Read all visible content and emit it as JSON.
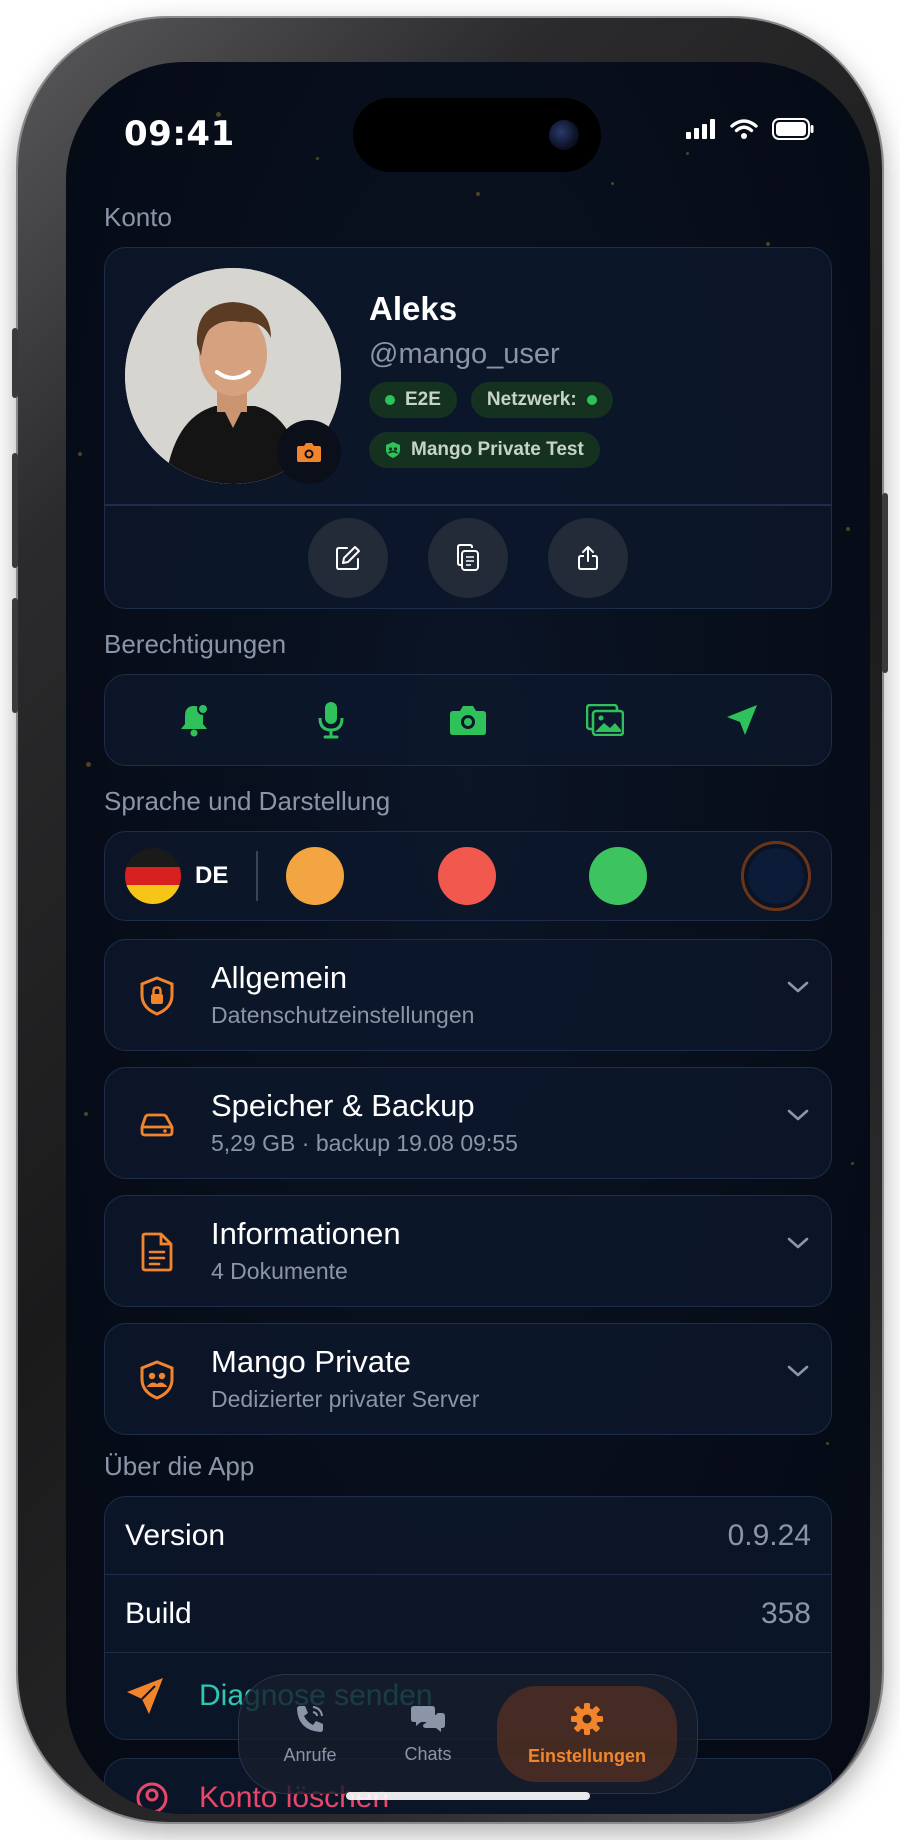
{
  "status_bar": {
    "time": "09:41"
  },
  "account": {
    "section_label": "Konto",
    "name": "Aleks",
    "handle": "@mango_user",
    "chips": [
      "E2E",
      "Netzwerk:",
      "Mango Private Test"
    ]
  },
  "permissions": {
    "section_label": "Berechtigungen",
    "icons": [
      "bell-icon",
      "microphone-icon",
      "camera-icon",
      "gallery-icon",
      "location-arrow-icon"
    ]
  },
  "appearance": {
    "section_label": "Sprache und Darstellung",
    "language_code": "DE",
    "swatches": [
      "#f2a541",
      "#f2594e",
      "#3ec45f",
      "#0c1b38"
    ]
  },
  "settings_rows": [
    {
      "title": "Allgemein",
      "subtitle": "Datenschutzeinstellungen",
      "icon": "shield-lock-icon"
    },
    {
      "title": "Speicher & Backup",
      "subtitle": "5,29 GB · backup 19.08 09:55",
      "icon": "drive-icon"
    },
    {
      "title": "Informationen",
      "subtitle": "4 Dokumente",
      "icon": "document-icon"
    },
    {
      "title": "Mango Private",
      "subtitle": "Dedizierter privater Server",
      "icon": "shield-users-icon"
    }
  ],
  "about": {
    "section_label": "Über die App",
    "version_label": "Version",
    "version_value": "0.9.24",
    "build_label": "Build",
    "build_value": "358",
    "diagnose_label": "Diagnose senden",
    "delete_label": "Konto löschen"
  },
  "tabbar": {
    "calls": "Anrufe",
    "chats": "Chats",
    "settings": "Einstellungen"
  },
  "colors": {
    "accent": "#f2852b",
    "green": "#2fc25a",
    "teal": "#2ec7b4",
    "danger": "#e8476a"
  }
}
